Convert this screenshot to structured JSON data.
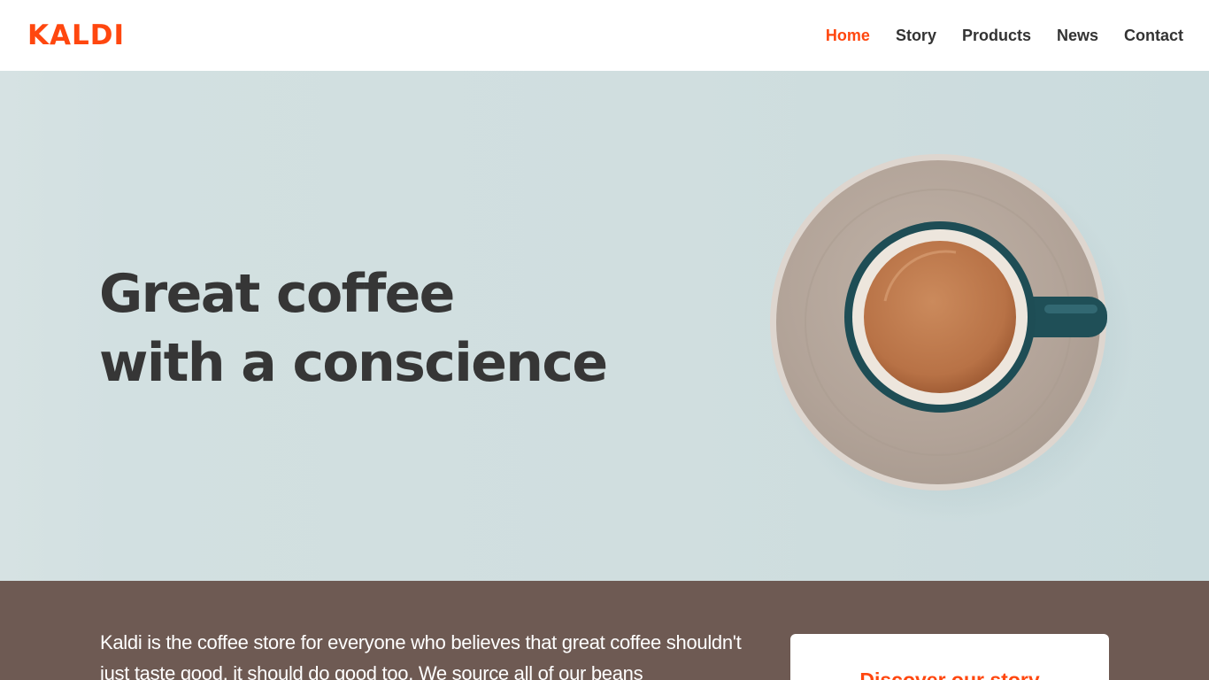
{
  "header": {
    "logo": "KALDI",
    "nav": [
      {
        "label": "Home",
        "active": true
      },
      {
        "label": "Story",
        "active": false
      },
      {
        "label": "Products",
        "active": false
      },
      {
        "label": "News",
        "active": false
      },
      {
        "label": "Contact",
        "active": false
      }
    ]
  },
  "hero": {
    "title_line1": "Great coffee",
    "title_line2": "with a conscience",
    "image": "coffee-cup-on-saucer"
  },
  "intro": {
    "text": "Kaldi is the coffee store for everyone who believes that great coffee shouldn't just taste good, it should do good too. We source all of our beans",
    "cta_label": "Discover our story"
  },
  "colors": {
    "accent": "#ff470f",
    "hero_background": "#d0dedf",
    "band_background": "#6e5a53",
    "text_dark": "#333333"
  }
}
